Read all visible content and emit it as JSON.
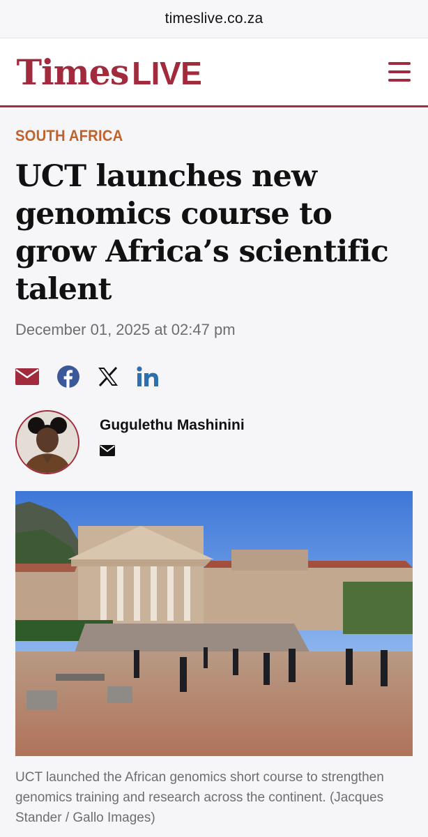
{
  "browser": {
    "url": "timeslive.co.za"
  },
  "header": {
    "logo_times": "Times",
    "logo_live": "LIVE",
    "brand_color": "#a12a3c"
  },
  "article": {
    "section": "SOUTH AFRICA",
    "section_color": "#c0622c",
    "headline": "UCT launches new genomics course to grow Africa’s scientific talent",
    "date": "December 01, 2025 at 02:47 pm",
    "share_icons": [
      "email-icon",
      "facebook-icon",
      "x-icon",
      "linkedin-icon"
    ],
    "author": {
      "name": "Gugulethu Mashinini",
      "contact_icon": "email-icon"
    },
    "image_caption": "UCT launched the African genomics short course to strengthen genomics training and research across the continent. (Jacques Stander / Gallo Images)"
  }
}
